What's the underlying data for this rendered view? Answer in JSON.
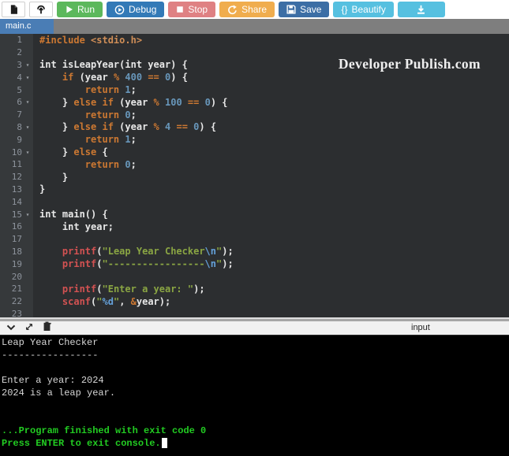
{
  "toolbar": {
    "run_label": "Run",
    "debug_label": "Debug",
    "stop_label": "Stop",
    "share_label": "Share",
    "save_label": "Save",
    "beautify_label": "Beautify",
    "beautify_icon_text": "{}"
  },
  "tabs": [
    {
      "label": "main.c",
      "active": true
    }
  ],
  "editor": {
    "watermark": "Developer Publish.com",
    "fold_lines": [
      3,
      4,
      6,
      8,
      10,
      15
    ],
    "lines": [
      [
        [
          "inc",
          "#include"
        ],
        [
          "pl",
          " "
        ],
        [
          "hdr",
          "<stdio.h>"
        ]
      ],
      [],
      [
        [
          "pl",
          "int isLeapYear(int year) {"
        ]
      ],
      [
        [
          "pl",
          "    "
        ],
        [
          "kw",
          "if"
        ],
        [
          "pl",
          " (year "
        ],
        [
          "kw",
          "%"
        ],
        [
          "pl",
          " "
        ],
        [
          "num",
          "400"
        ],
        [
          "pl",
          " "
        ],
        [
          "kw",
          "=="
        ],
        [
          "pl",
          " "
        ],
        [
          "num",
          "0"
        ],
        [
          "pl",
          ") {"
        ]
      ],
      [
        [
          "pl",
          "        "
        ],
        [
          "kw",
          "return"
        ],
        [
          "pl",
          " "
        ],
        [
          "num",
          "1"
        ],
        [
          "pl",
          ";"
        ]
      ],
      [
        [
          "pl",
          "    } "
        ],
        [
          "kw",
          "else"
        ],
        [
          "pl",
          " "
        ],
        [
          "kw",
          "if"
        ],
        [
          "pl",
          " (year "
        ],
        [
          "kw",
          "%"
        ],
        [
          "pl",
          " "
        ],
        [
          "num",
          "100"
        ],
        [
          "pl",
          " "
        ],
        [
          "kw",
          "=="
        ],
        [
          "pl",
          " "
        ],
        [
          "num",
          "0"
        ],
        [
          "pl",
          ") {"
        ]
      ],
      [
        [
          "pl",
          "        "
        ],
        [
          "kw",
          "return"
        ],
        [
          "pl",
          " "
        ],
        [
          "num",
          "0"
        ],
        [
          "pl",
          ";"
        ]
      ],
      [
        [
          "pl",
          "    } "
        ],
        [
          "kw",
          "else"
        ],
        [
          "pl",
          " "
        ],
        [
          "kw",
          "if"
        ],
        [
          "pl",
          " (year "
        ],
        [
          "kw",
          "%"
        ],
        [
          "pl",
          " "
        ],
        [
          "num",
          "4"
        ],
        [
          "pl",
          " "
        ],
        [
          "kw",
          "=="
        ],
        [
          "pl",
          " "
        ],
        [
          "num",
          "0"
        ],
        [
          "pl",
          ") {"
        ]
      ],
      [
        [
          "pl",
          "        "
        ],
        [
          "kw",
          "return"
        ],
        [
          "pl",
          " "
        ],
        [
          "num",
          "1"
        ],
        [
          "pl",
          ";"
        ]
      ],
      [
        [
          "pl",
          "    } "
        ],
        [
          "kw",
          "else"
        ],
        [
          "pl",
          " {"
        ]
      ],
      [
        [
          "pl",
          "        "
        ],
        [
          "kw",
          "return"
        ],
        [
          "pl",
          " "
        ],
        [
          "num",
          "0"
        ],
        [
          "pl",
          ";"
        ]
      ],
      [
        [
          "pl",
          "    }"
        ]
      ],
      [
        [
          "pl",
          "}"
        ]
      ],
      [],
      [
        [
          "pl",
          "int main() {"
        ]
      ],
      [
        [
          "pl",
          "    int year;"
        ]
      ],
      [],
      [
        [
          "pl",
          "    "
        ],
        [
          "fn",
          "printf"
        ],
        [
          "pl",
          "("
        ],
        [
          "str",
          "\"Leap Year Checker"
        ],
        [
          "esc",
          "\\n"
        ],
        [
          "str",
          "\""
        ],
        [
          "pl",
          ");"
        ]
      ],
      [
        [
          "pl",
          "    "
        ],
        [
          "fn",
          "printf"
        ],
        [
          "pl",
          "("
        ],
        [
          "str",
          "\"-----------------"
        ],
        [
          "esc",
          "\\n"
        ],
        [
          "str",
          "\""
        ],
        [
          "pl",
          ");"
        ]
      ],
      [],
      [
        [
          "pl",
          "    "
        ],
        [
          "fn",
          "printf"
        ],
        [
          "pl",
          "("
        ],
        [
          "str",
          "\"Enter a year: \""
        ],
        [
          "pl",
          ");"
        ]
      ],
      [
        [
          "pl",
          "    "
        ],
        [
          "fn",
          "scanf"
        ],
        [
          "pl",
          "("
        ],
        [
          "str",
          "\""
        ],
        [
          "esc",
          "%d"
        ],
        [
          "str",
          "\""
        ],
        [
          "pl",
          ", "
        ],
        [
          "kw",
          "&"
        ],
        [
          "pl",
          "year);"
        ]
      ],
      []
    ]
  },
  "console": {
    "input_label": "input",
    "lines": [
      {
        "text": "Leap Year Checker",
        "style": "out"
      },
      {
        "text": "-----------------",
        "style": "out"
      },
      {
        "text": "",
        "style": "out"
      },
      {
        "text": "Enter a year: 2024",
        "style": "out"
      },
      {
        "text": "2024 is a leap year.",
        "style": "out"
      },
      {
        "text": "",
        "style": "out"
      },
      {
        "text": "",
        "style": "out"
      },
      {
        "text": "...Program finished with exit code 0",
        "style": "status"
      },
      {
        "text": "Press ENTER to exit console.",
        "style": "status",
        "cursor": true
      }
    ]
  },
  "colors": {
    "run_button": "#5cb85c",
    "debug_button": "#337ab7",
    "stop_button": "#df8183",
    "share_button": "#f0ad4e",
    "save_button": "#3c6ea5",
    "beautify_button": "#56c0e0",
    "tab_active": "#4a7db5",
    "editor_bg": "#2c2e30",
    "keyword": "#cc7832",
    "number": "#6897bb",
    "string": "#8aa543",
    "function": "#d25252",
    "console_status_green": "#22cc22"
  }
}
